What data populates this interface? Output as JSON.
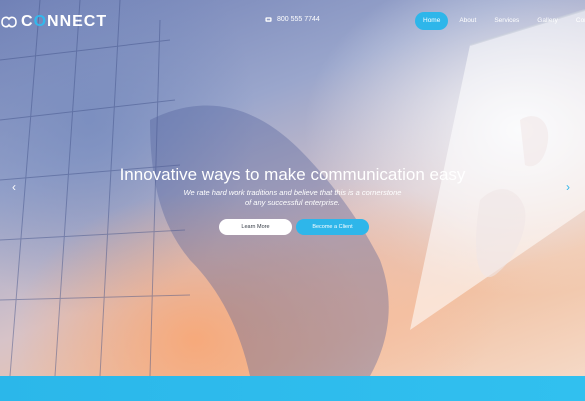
{
  "header": {
    "logo": {
      "prefix": "C",
      "accent": "O",
      "rest": "NNECT"
    },
    "phone": "800 555 7744",
    "menu": [
      {
        "label": "Home",
        "active": true
      },
      {
        "label": "About",
        "active": false
      },
      {
        "label": "Services",
        "active": false
      },
      {
        "label": "Gallery",
        "active": false
      },
      {
        "label": "Contacts",
        "active": false
      }
    ]
  },
  "hero": {
    "title": "Innovative ways to make communication easy",
    "subtitle_line1": "We rate hard work traditions and believe that this is a cornerstone",
    "subtitle_line2": "of any successful enterprise.",
    "primary_button": "Learn More",
    "secondary_button": "Become a Client"
  },
  "colors": {
    "accent": "#2eb6ea",
    "text_on_dark": "#ffffff"
  },
  "icons": {
    "phone": "phone-icon",
    "prev": "chevron-left-icon",
    "next": "chevron-right-icon",
    "logo": "connect-logo-icon"
  }
}
